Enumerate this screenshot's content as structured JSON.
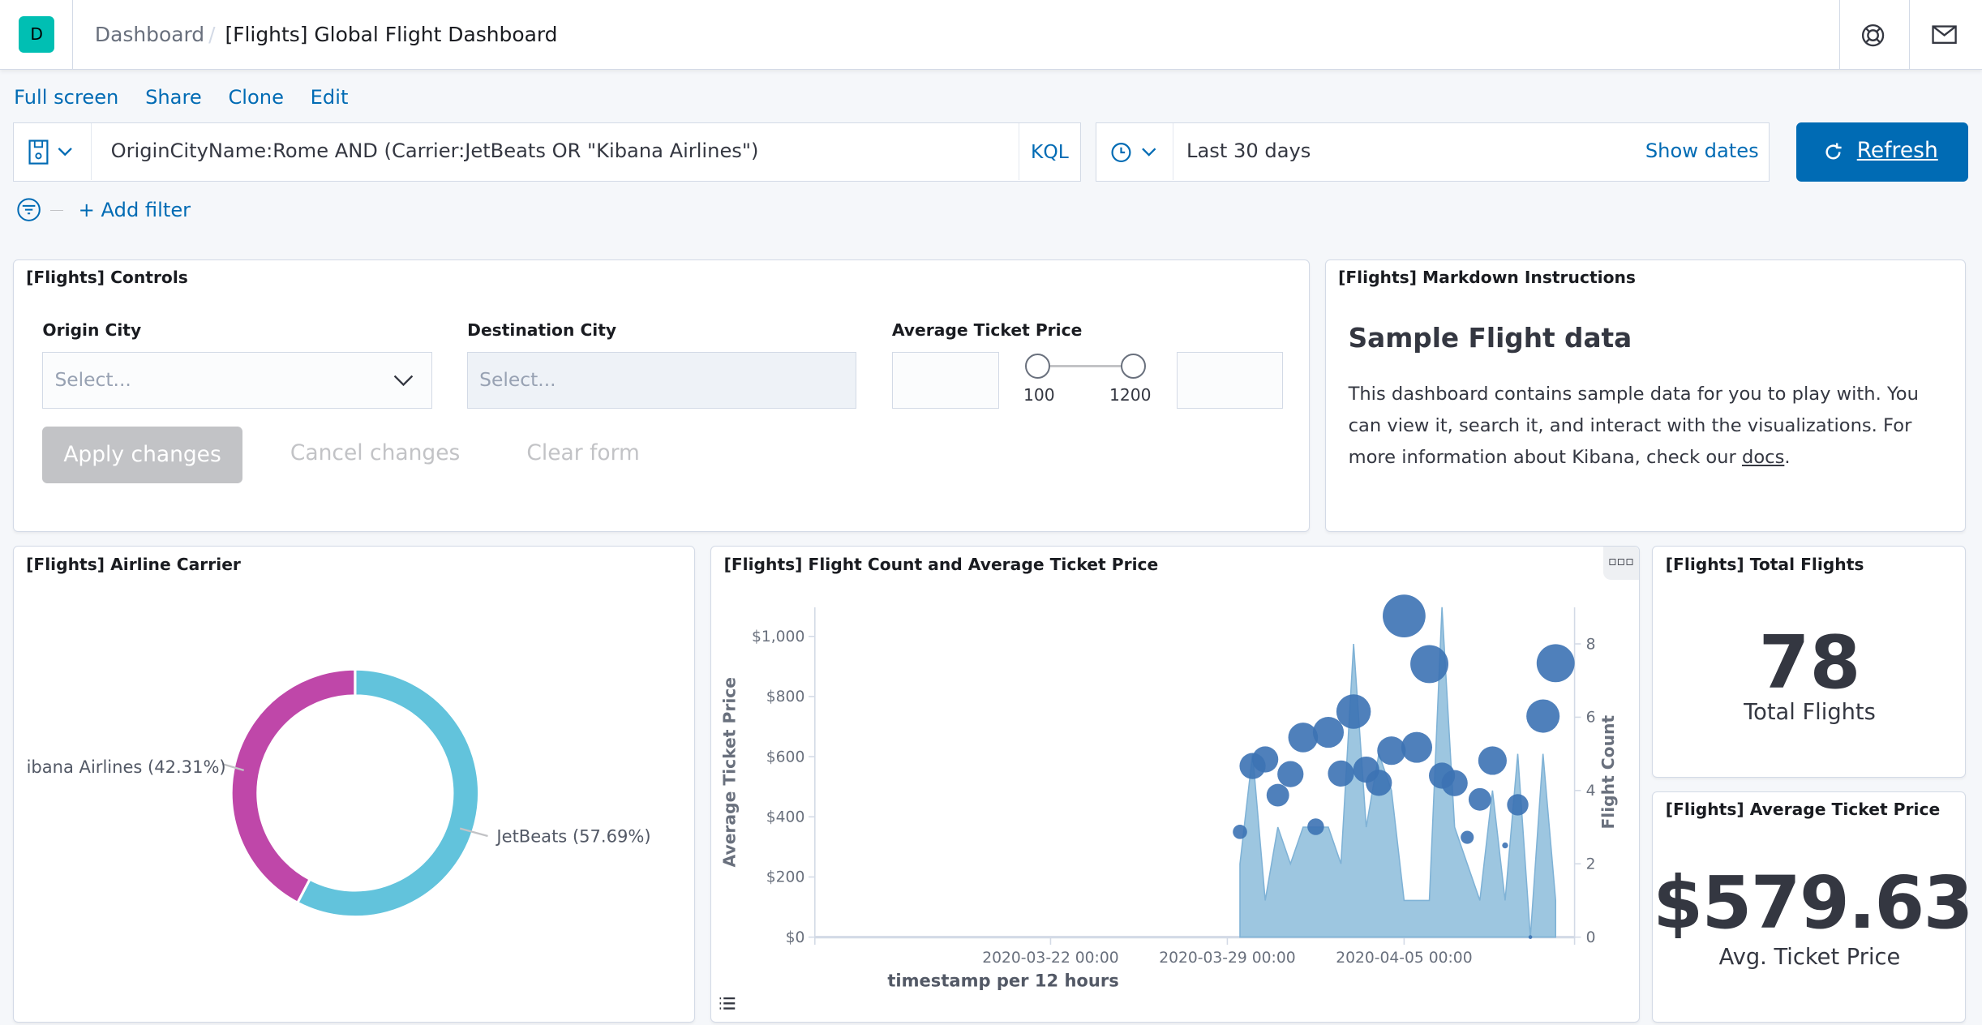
{
  "header": {
    "logo_letter": "D",
    "breadcrumb_root": "Dashboard",
    "breadcrumb_sep": "/",
    "title": "[Flights] Global Flight Dashboard",
    "icons": [
      "help-icon",
      "mail-icon"
    ]
  },
  "top_nav": [
    "Full screen",
    "Share",
    "Clone",
    "Edit"
  ],
  "query": {
    "value": "OriginCityName:Rome AND (Carrier:JetBeats OR \"Kibana Airlines\")",
    "language": "KQL"
  },
  "time": {
    "range": "Last 30 days",
    "show_dates": "Show dates",
    "refresh": "Refresh"
  },
  "filters": {
    "add_filter": "+ Add filter"
  },
  "controls": {
    "title": "[Flights] Controls",
    "origin_label": "Origin City",
    "origin_placeholder": "Select...",
    "dest_label": "Destination City",
    "dest_placeholder": "Select...",
    "price_label": "Average Ticket Price",
    "price_min": "100",
    "price_max": "1200",
    "apply": "Apply changes",
    "cancel": "Cancel changes",
    "clear": "Clear form"
  },
  "markdown": {
    "title": "[Flights] Markdown Instructions",
    "heading": "Sample Flight data",
    "text_before": "This dashboard contains sample data for you to play with. You can view it, search it, and interact with the visualizations. For more information about Kibana, check our ",
    "link": "docs",
    "text_after": "."
  },
  "total_flights": {
    "title": "[Flights] Total Flights",
    "value": "78",
    "label": "Total Flights"
  },
  "avg_price": {
    "title": "[Flights] Average Ticket Price",
    "value": "$579.63",
    "label": "Avg. Ticket Price"
  },
  "colors": {
    "accent": "#006bb4",
    "logo": "#00bfb3",
    "jetbeats": "#62c3dc",
    "kibana_airlines": "#bf47a9",
    "bubble": "#3c72b4",
    "area": "#8cbcdb"
  },
  "chart_data": [
    {
      "type": "pie",
      "title": "[Flights] Airline Carrier",
      "donut": true,
      "slices": [
        {
          "label": "JetBeats (57.69%)",
          "name": "JetBeats",
          "value": 57.69
        },
        {
          "label": "ibana Airlines (42.31%)",
          "name": "Kibana Airlines",
          "value": 42.31
        }
      ]
    },
    {
      "type": "area+scatter",
      "title": "[Flights] Flight Count and Average Ticket Price",
      "xlabel": "timestamp per 12 hours",
      "ylabel_left": "Average Ticket Price",
      "ylabel_right": "Flight Count",
      "x_ticks": [
        "2020-03-22 00:00",
        "2020-03-29 00:00",
        "2020-04-05 00:00"
      ],
      "y_left_ticks": [
        "$0",
        "$200",
        "$400",
        "$600",
        "$800",
        "$1,000"
      ],
      "y_right_ticks": [
        "0",
        "2",
        "4",
        "6",
        "8"
      ],
      "xlim": [
        "2020-03-12T16:00",
        "2020-04-11T18:00"
      ],
      "ylim_left": [
        0,
        1097
      ],
      "ylim_right": [
        0,
        9
      ],
      "x": [
        "2020-03-29T12:00",
        "2020-03-30T00:00",
        "2020-03-30T12:00",
        "2020-03-31T00:00",
        "2020-03-31T12:00",
        "2020-04-01T00:00",
        "2020-04-01T12:00",
        "2020-04-02T00:00",
        "2020-04-02T12:00",
        "2020-04-03T00:00",
        "2020-04-03T12:00",
        "2020-04-04T00:00",
        "2020-04-04T12:00",
        "2020-04-05T00:00",
        "2020-04-05T12:00",
        "2020-04-06T00:00",
        "2020-04-06T12:00",
        "2020-04-07T00:00",
        "2020-04-07T12:00",
        "2020-04-08T00:00",
        "2020-04-08T12:00",
        "2020-04-09T00:00",
        "2020-04-09T12:00",
        "2020-04-10T00:00",
        "2020-04-10T12:00",
        "2020-04-11T00:00"
      ],
      "series": [
        {
          "name": "Flight Count",
          "type": "area",
          "axis": "right",
          "values": [
            2,
            5,
            1,
            3,
            2,
            3,
            3,
            3,
            2,
            8,
            3,
            5,
            4,
            1,
            1,
            1,
            9,
            3,
            2,
            1,
            4,
            1,
            5,
            0,
            5,
            1
          ]
        },
        {
          "name": "Average Ticket Price",
          "type": "bubble",
          "axis": "left",
          "values": [
            350,
            569,
            591,
            472,
            542,
            664,
            367,
            681,
            544,
            750,
            557,
            513,
            620,
            1068,
            631,
            908,
            537,
            512,
            332,
            458,
            587,
            305,
            440,
            0,
            735,
            911
          ],
          "bubble_size": [
            12,
            22,
            22,
            19,
            22,
            25,
            14,
            26,
            22,
            29,
            22,
            22,
            24,
            36,
            26,
            32,
            22,
            22,
            11,
            19,
            24,
            5,
            18,
            3,
            28,
            32
          ]
        }
      ]
    }
  ]
}
